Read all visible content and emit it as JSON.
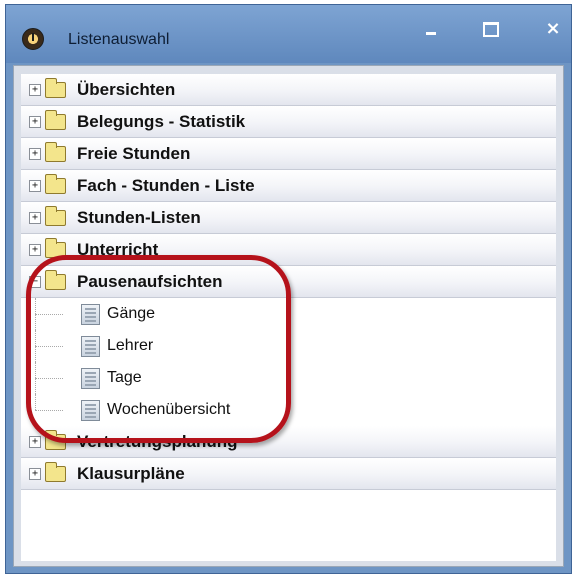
{
  "window": {
    "title": "Listenauswahl",
    "controls": {
      "minimize": "minimize",
      "maximize": "maximize",
      "close": "×"
    }
  },
  "tree": {
    "groups": [
      {
        "label": "Übersichten",
        "expanded": false,
        "expander": "+"
      },
      {
        "label": "Belegungs - Statistik",
        "expanded": false,
        "expander": "+"
      },
      {
        "label": "Freie Stunden",
        "expanded": false,
        "expander": "+"
      },
      {
        "label": "Fach - Stunden - Liste",
        "expanded": false,
        "expander": "+"
      },
      {
        "label": "Stunden-Listen",
        "expanded": false,
        "expander": "+"
      },
      {
        "label": "Unterricht",
        "expanded": false,
        "expander": "+"
      },
      {
        "label": "Pausenaufsichten",
        "expanded": true,
        "expander": "−"
      },
      {
        "label": "Vertretungsplanung",
        "expanded": false,
        "expander": "+"
      },
      {
        "label": "Klausurpläne",
        "expanded": false,
        "expander": "+"
      }
    ],
    "children": [
      {
        "label": "Gänge"
      },
      {
        "label": "Lehrer"
      },
      {
        "label": "Tage"
      },
      {
        "label": "Wochenübersicht"
      }
    ]
  },
  "colors": {
    "highlight": "#b5121b",
    "titlebar": "#6e95c4"
  }
}
